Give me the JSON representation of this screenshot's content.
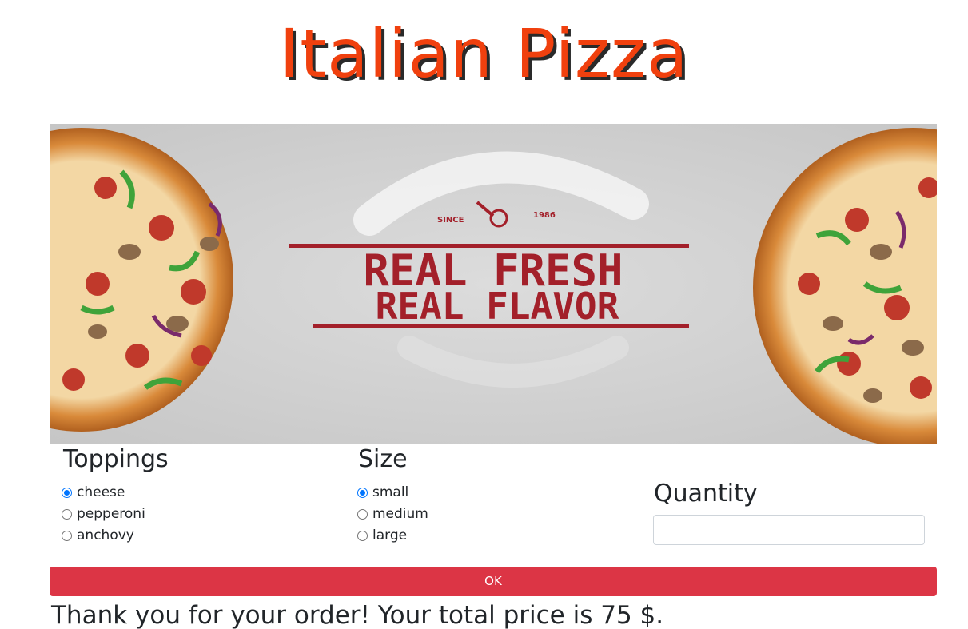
{
  "header": {
    "title": "Italian Pizza"
  },
  "banner": {
    "headline_line1": "REAL FRESH",
    "headline_line2": "REAL FLAVOR",
    "since_label": "SINCE",
    "year_label": "1986"
  },
  "toppings": {
    "title": "Toppings",
    "options": [
      {
        "label": "cheese",
        "selected": true
      },
      {
        "label": "pepperoni",
        "selected": false
      },
      {
        "label": "anchovy",
        "selected": false
      }
    ]
  },
  "size": {
    "title": "Size",
    "options": [
      {
        "label": "small",
        "selected": true
      },
      {
        "label": "medium",
        "selected": false
      },
      {
        "label": "large",
        "selected": false
      }
    ]
  },
  "quantity": {
    "title": "Quantity",
    "value": ""
  },
  "ok_button": {
    "label": "OK",
    "color": "#dc3545"
  },
  "result": {
    "text": "Thank you for your order! Your total price is 75 $."
  },
  "colors": {
    "title": "#f0400e",
    "accent": "#0075ff",
    "headline": "#a3202a"
  }
}
